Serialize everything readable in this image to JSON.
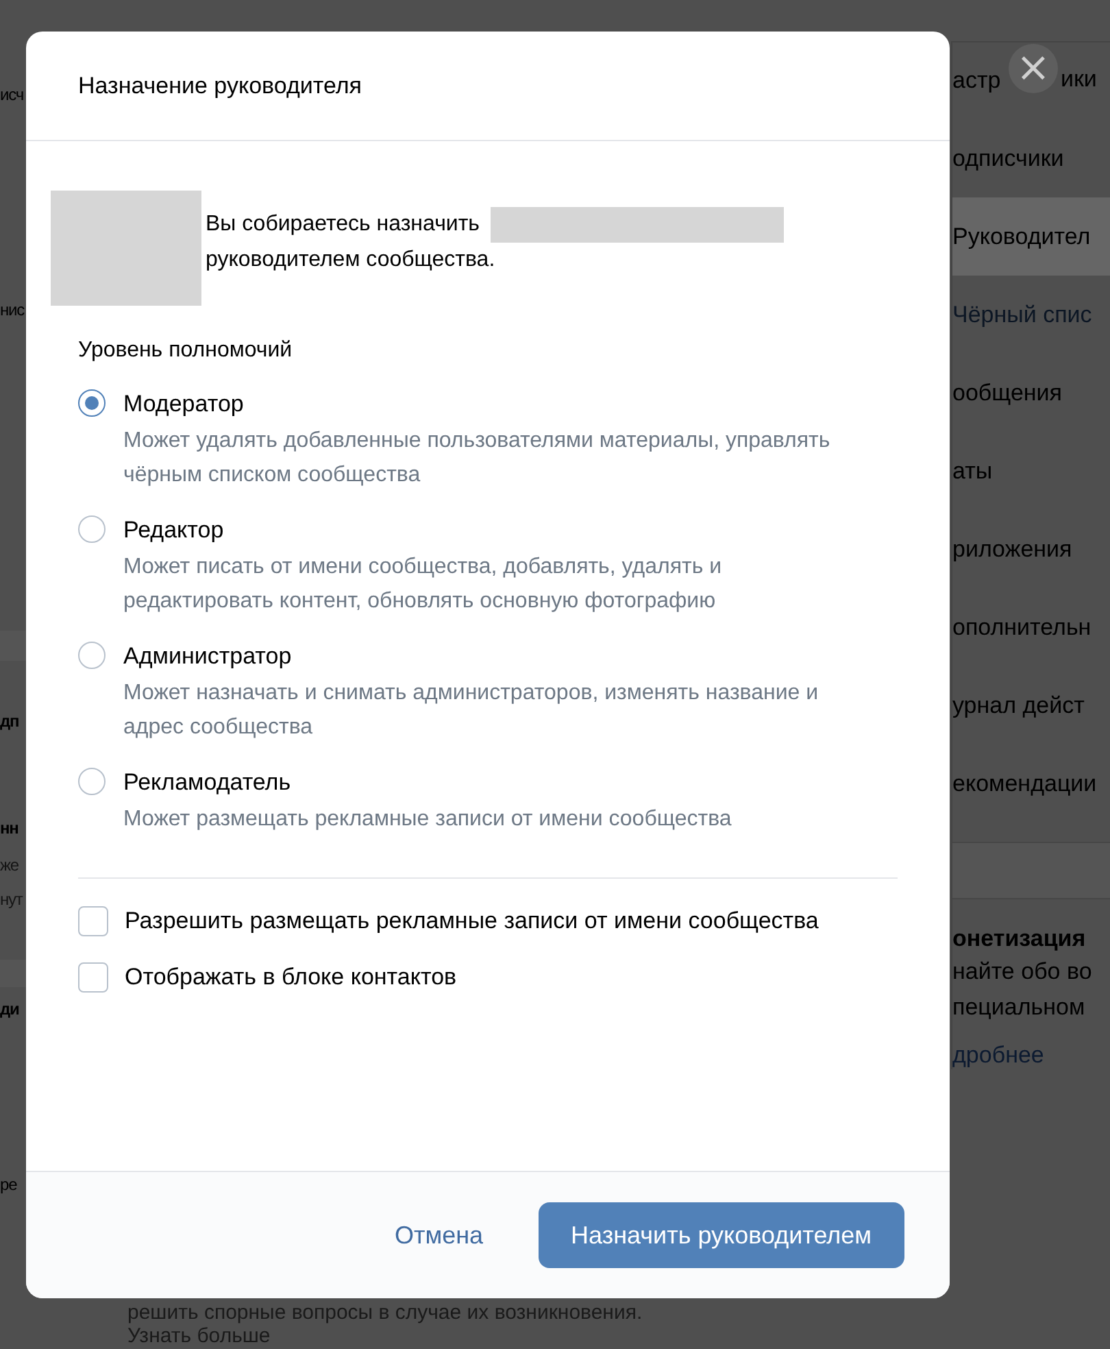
{
  "background": {
    "left_fragments": [
      {
        "text": "исч",
        "kind": "plain"
      },
      {
        "text": "нис",
        "kind": "plain"
      },
      {
        "text": "дп",
        "kind": "bold"
      },
      {
        "text": "нн",
        "kind": "bold"
      },
      {
        "text": "же",
        "kind": "muted"
      },
      {
        "text": "нут",
        "kind": "muted"
      },
      {
        "text": "ди",
        "kind": "bold"
      },
      {
        "text": "ре",
        "kind": "plain"
      }
    ],
    "sidebar": [
      {
        "label": "астр",
        "tail": "ики",
        "kind": "item",
        "selected": false
      },
      {
        "label": "одписчики",
        "kind": "item",
        "selected": false
      },
      {
        "label": "Руководител",
        "kind": "item",
        "selected": true
      },
      {
        "label": "Чёрный спис",
        "kind": "subitem",
        "selected": false
      },
      {
        "label": "ообщения",
        "kind": "item",
        "selected": false
      },
      {
        "label": "аты",
        "kind": "item",
        "selected": false
      },
      {
        "label": "риложения",
        "kind": "item",
        "selected": false
      },
      {
        "label": "ополнительн",
        "kind": "item",
        "selected": false
      },
      {
        "label": "урнал дейст",
        "kind": "item",
        "selected": false
      },
      {
        "label": "екомендации",
        "kind": "item",
        "selected": false
      }
    ],
    "promo": {
      "title": "онетизация",
      "lines": [
        "найте обо во",
        "пециальном"
      ],
      "link": "дробнее"
    },
    "bottom_lines": [
      "решить спорные вопросы в случае их возникновения.",
      "Узнать больше"
    ]
  },
  "dialog": {
    "title": "Назначение руководителя",
    "close": "×",
    "message_before": "Вы собираетесь назначить",
    "message_after": "руководителем сообщества.",
    "level_heading": "Уровень полномочий",
    "roles": [
      {
        "label": "Модератор",
        "description": "Может удалять добавленные пользователями материалы, управлять чёрным списком сообщества",
        "selected": true
      },
      {
        "label": "Редактор",
        "description": "Может писать от имени сообщества, добавлять, удалять и редактировать контент, обновлять основную фотографию",
        "selected": false
      },
      {
        "label": "Администратор",
        "description": "Может назначать и снимать администраторов, изменять название и адрес сообщества",
        "selected": false
      },
      {
        "label": "Рекламодатель",
        "description": "Может размещать рекламные записи от имени сообщества",
        "selected": false
      }
    ],
    "options": [
      {
        "label": "Разрешить размещать рекламные записи от имени сообщества",
        "checked": false
      },
      {
        "label": "Отображать в блоке контактов",
        "checked": false
      }
    ],
    "cancel": "Отмена",
    "submit": "Назначить руководителем"
  }
}
